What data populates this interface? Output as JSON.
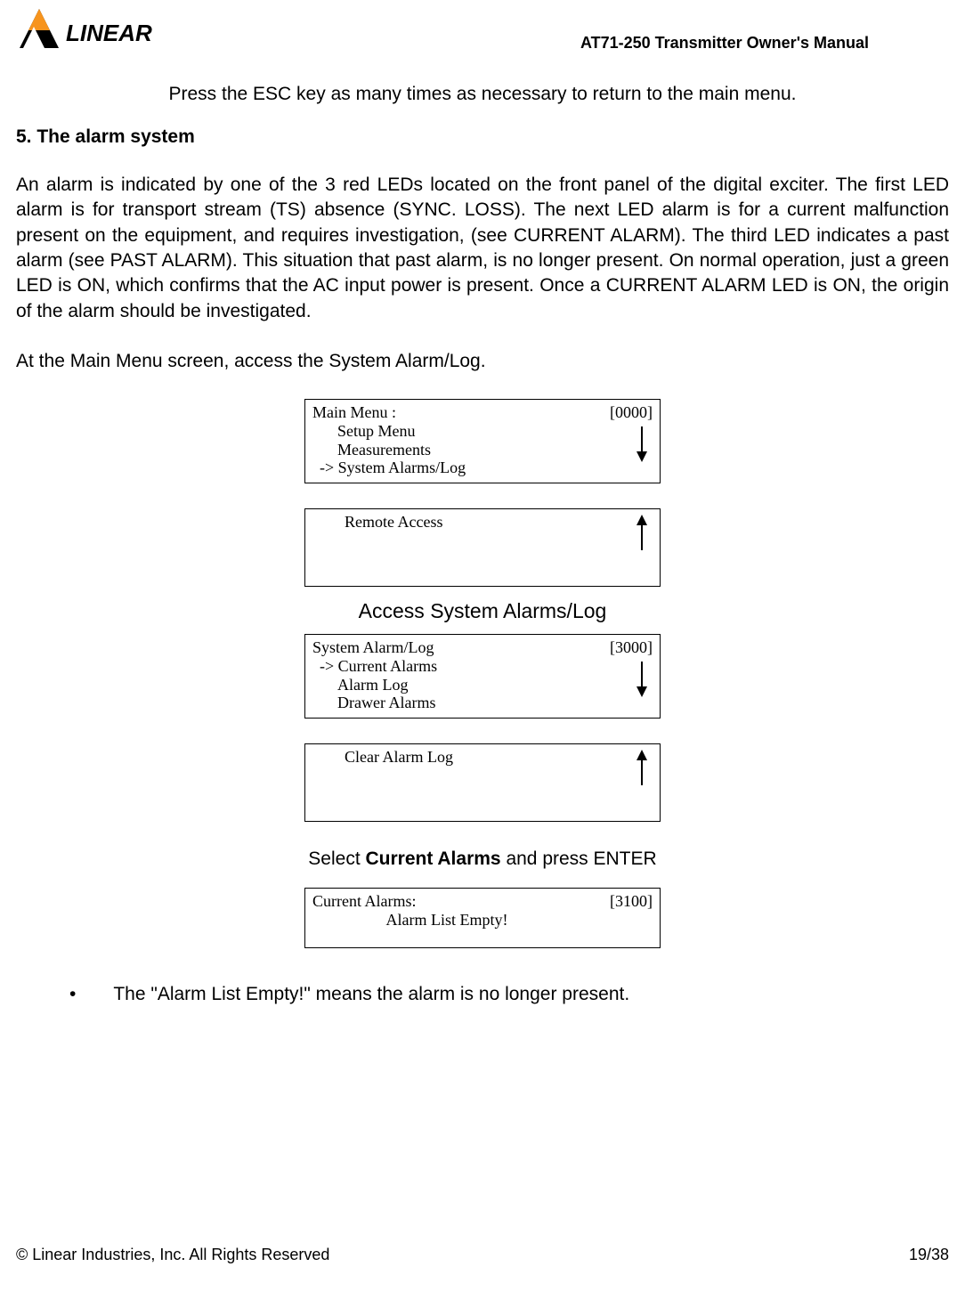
{
  "header": {
    "brand": "LINEAR",
    "doc_title": "AT71-250 Transmitter Owner's Manual"
  },
  "intro": "Press the ESC key as many times as necessary to return to the main menu.",
  "section_heading": "5. The alarm system",
  "para1": "An alarm is indicated by one of the 3 red LEDs located on the front panel of the digital exciter. The first LED alarm is for transport stream (TS) absence (SYNC. LOSS). The next LED alarm is for a current malfunction present on the equipment, and requires investigation, (see CURRENT ALARM).  The third LED indicates a past alarm (see PAST ALARM). This situation that past alarm, is no longer present. On normal operation, just a green LED is ON, which confirms that the AC input power is present. Once a CURRENT ALARM LED is ON, the origin of the alarm should be investigated.",
  "para2": "At the Main Menu screen, access the System Alarm/Log.",
  "menu1": {
    "title": "Main Menu :",
    "code": "[0000]",
    "items": [
      "Setup Menu",
      "Measurements",
      "-> System Alarms/Log"
    ]
  },
  "menu1b": {
    "line": "Remote Access"
  },
  "caption_mid": "Access System Alarms/Log",
  "menu2": {
    "title": "System Alarm/Log",
    "code": "[3000]",
    "items": [
      "-> Current Alarms",
      "Alarm Log",
      "Drawer Alarms"
    ]
  },
  "menu2b": {
    "line": "Clear Alarm Log"
  },
  "caption_instr_pre": "Select ",
  "caption_instr_bold": "Current Alarms",
  "caption_instr_post": " and press ENTER",
  "menu3": {
    "title": "Current Alarms:",
    "code": "[3100]",
    "line": "Alarm List Empty!"
  },
  "bullet": "The \"Alarm List Empty!\" means the alarm is no longer present.",
  "footer": {
    "left": "© Linear Industries, Inc. All Rights Reserved",
    "right": "19/38"
  }
}
